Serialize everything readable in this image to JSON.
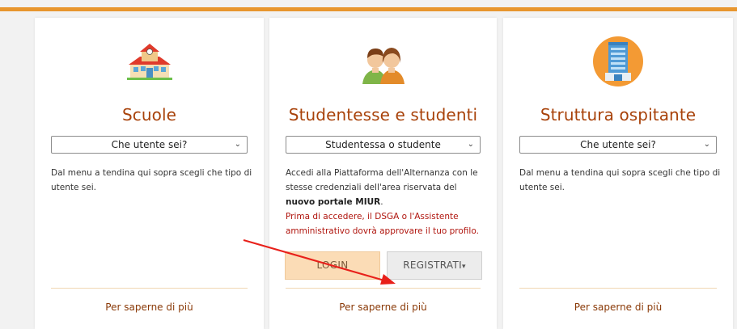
{
  "cards": [
    {
      "icon": "school-building-icon",
      "title": "Scuole",
      "select_value": "Che utente sei?",
      "description": "Dal menu a tendina qui sopra scegli che tipo di utente sei.",
      "more_link": "Per saperne di più"
    },
    {
      "icon": "students-icon",
      "title": "Studentesse e studenti",
      "select_value": "Studentessa o studente",
      "description_before": "Accedi alla Piattaforma dell'Alternanza con le stesse credenziali dell'area riservata del ",
      "description_bold": "nuovo portale MIUR",
      "description_after": ".",
      "warning": "Prima di accedere, il DSGA o l'Assistente amministrativo dovrà approvare il tuo profilo.",
      "login_label": "LOGIN",
      "register_label": "REGISTRATI",
      "more_link": "Per saperne di più"
    },
    {
      "icon": "office-building-icon",
      "title": "Struttura ospitante",
      "select_value": "Che utente sei?",
      "description": "Dal menu a tendina qui sopra scegli che tipo di utente sei.",
      "more_link": "Per saperne di più"
    }
  ],
  "colors": {
    "accent_orange": "#e8962e",
    "title_color": "#a8420a",
    "warning_red": "#b0150e",
    "annotation_arrow": "#e8201a"
  }
}
